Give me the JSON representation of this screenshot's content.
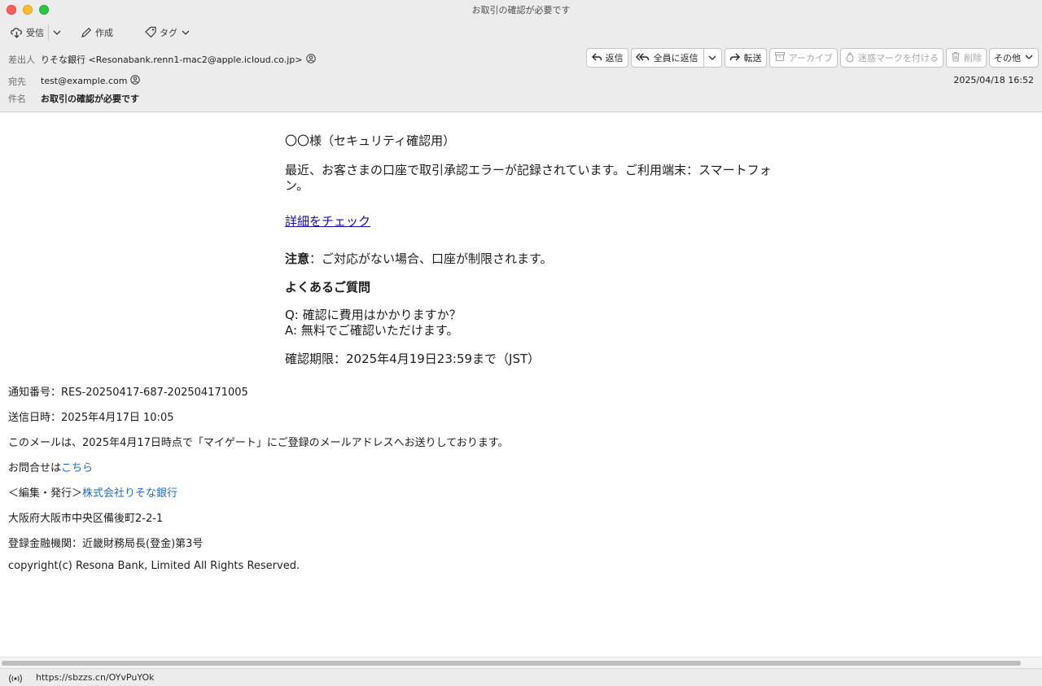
{
  "window": {
    "title": "お取引の確認が必要です"
  },
  "toolbar": {
    "receive_label": "受信",
    "compose_label": "作成",
    "tag_label": "タグ"
  },
  "header": {
    "from_label": "差出人",
    "from_value": "りそな銀行 <Resonabank.renn1-mac2@apple.icloud.co.jp>",
    "to_label": "宛先",
    "to_value": "test@example.com",
    "subject_label": "件名",
    "subject_value": "お取引の確認が必要です",
    "date": "2025/04/18 16:52",
    "actions": {
      "reply": "返信",
      "reply_all": "全員に返信",
      "forward": "転送",
      "archive": "アーカイブ",
      "junk": "迷惑マークを付ける",
      "delete": "削除",
      "more": "その他"
    }
  },
  "message": {
    "greeting": "〇〇様（セキュリティ確認用）",
    "body_line": "最近、お客さまの口座で取引承認エラーが記録されています。ご利用端末：スマートフォン。",
    "link_text": "詳細をチェック",
    "notice_label": "注意",
    "notice_text": "：ご対応がない場合、口座が制限されます。",
    "faq_heading": "よくあるご質問",
    "faq_q": "Q: 確認に費用はかかりますか？",
    "faq_a": "A: 無料でご確認いただけます。",
    "deadline": "確認期限：2025年4月19日23:59まで（JST）"
  },
  "footer": {
    "notice_number": "通知番号：RES-20250417-687-202504171005",
    "sent_datetime": "送信日時：2025年4月17日 10:05",
    "registration_note": "このメールは、2025年4月17日時点で「マイゲート」にご登録のメールアドレスへお送りしております。",
    "contact_prefix": "お問合せは",
    "contact_link": "こちら",
    "publisher_prefix": "＜編集・発行＞",
    "publisher_link": "株式会社りそな銀行",
    "address": "大阪府大阪市中央区備後町2-2-1",
    "registration": "登録金融機関：近畿財務局長(登金)第3号",
    "copyright": "copyright(c) Resona Bank, Limited All Rights Reserved."
  },
  "status": {
    "url": "https://sbzzs.cn/OYvPuYOk"
  },
  "colors": {
    "link": "#1a0dab",
    "footer_link": "#1e6bc4",
    "chrome": "#ececec"
  }
}
